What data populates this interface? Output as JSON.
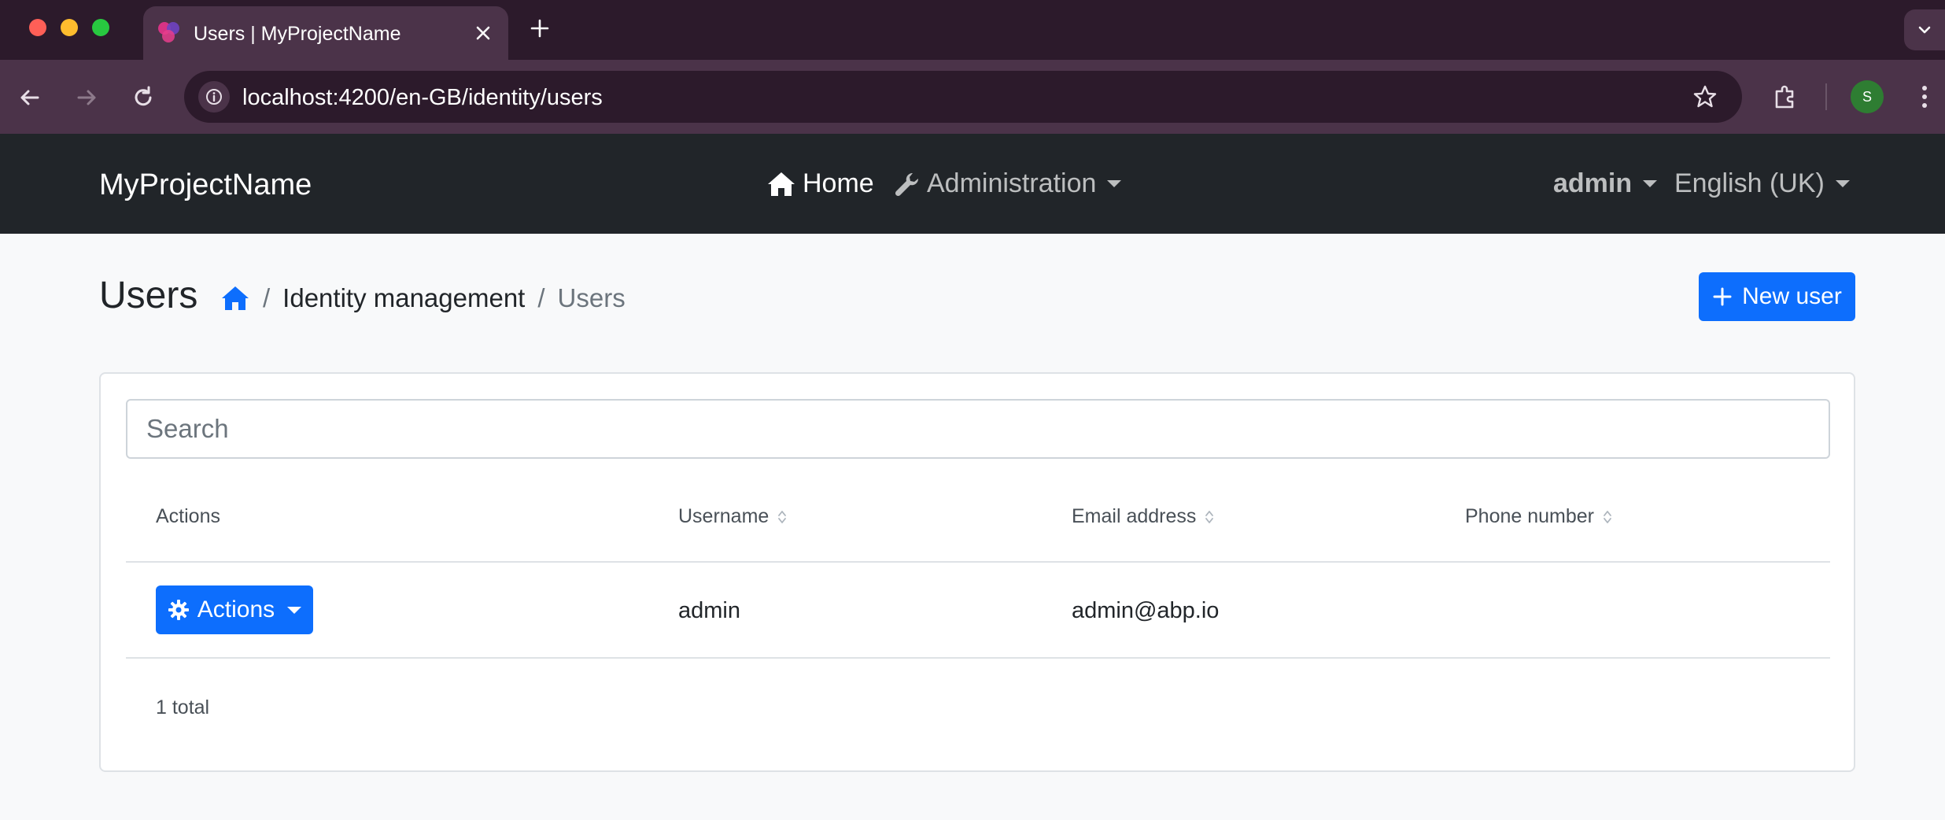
{
  "browser": {
    "tab_title": "Users | MyProjectName",
    "url": "localhost:4200/en-GB/identity/users",
    "profile_initial": "S"
  },
  "navbar": {
    "brand": "MyProjectName",
    "home_label": "Home",
    "administration_label": "Administration",
    "user_label": "admin",
    "language_label": "English (UK)"
  },
  "page": {
    "title": "Users",
    "breadcrumb": {
      "separator": "/",
      "section": "Identity management",
      "current": "Users"
    },
    "new_user_label": "New user"
  },
  "table": {
    "search_placeholder": "Search",
    "headers": {
      "actions": "Actions",
      "username": "Username",
      "email": "Email address",
      "phone": "Phone number"
    },
    "rows": [
      {
        "actions_label": "Actions",
        "username": "admin",
        "email": "admin@abp.io",
        "phone": ""
      }
    ],
    "total_text": "1 total"
  },
  "colors": {
    "primary": "#0d6efd",
    "navbar_bg": "#212529",
    "page_bg": "#f8f9fa",
    "browser_frame": "#2c1a2b",
    "browser_toolbar": "#4b3349"
  }
}
